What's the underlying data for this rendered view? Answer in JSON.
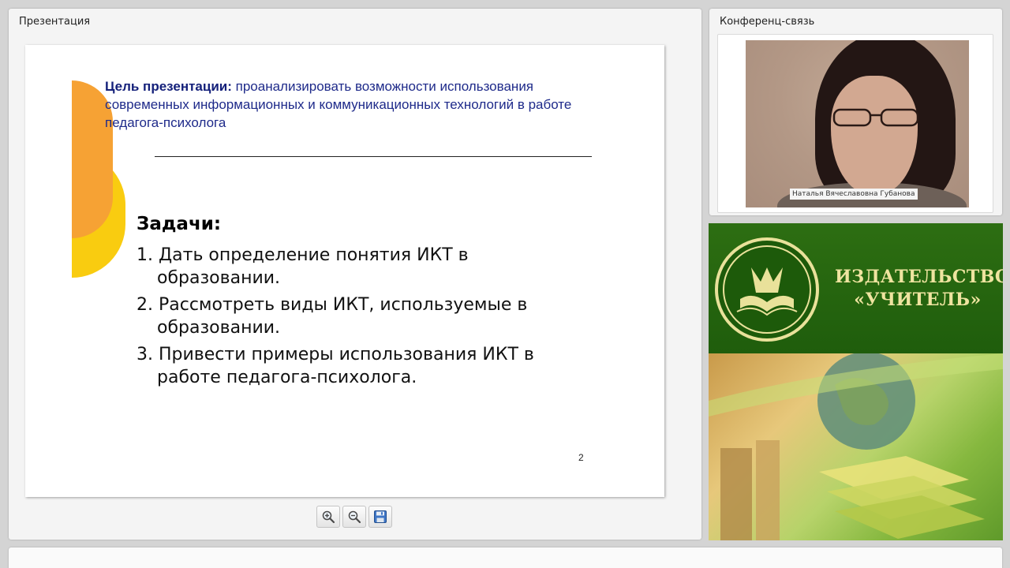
{
  "presentation_panel": {
    "title": "Презентация",
    "slide": {
      "goal_label": "Цель презентации:",
      "goal_text": " проанализировать возможности использования современных информационных и коммуникационных технологий в работе педагога-психолога",
      "tasks_title": "Задачи:",
      "tasks": [
        "1. Дать определение понятия ИКТ в образовании.",
        "2. Рассмотреть виды ИКТ, используемые в образовании.",
        "3. Привести примеры использования ИКТ в работе педагога-психолога."
      ],
      "page_number": "2",
      "colors": {
        "orange": "#f6a234",
        "yellow": "#f9cc10",
        "goal_text": "#1e2a8a"
      }
    },
    "toolbar": {
      "icons": [
        "zoom-in-icon",
        "zoom-out-icon",
        "save-icon"
      ]
    }
  },
  "conference_panel": {
    "title": "Конференц-связь",
    "participant_name": "Наталья Вячеславовна Губанова"
  },
  "ad_banner": {
    "line1": "ИЗДАТЕЛЬСТВО",
    "line2": "«УЧИТЕЛЬ»",
    "colors": {
      "background": "#2d6e12",
      "text": "#efe4a0"
    }
  }
}
